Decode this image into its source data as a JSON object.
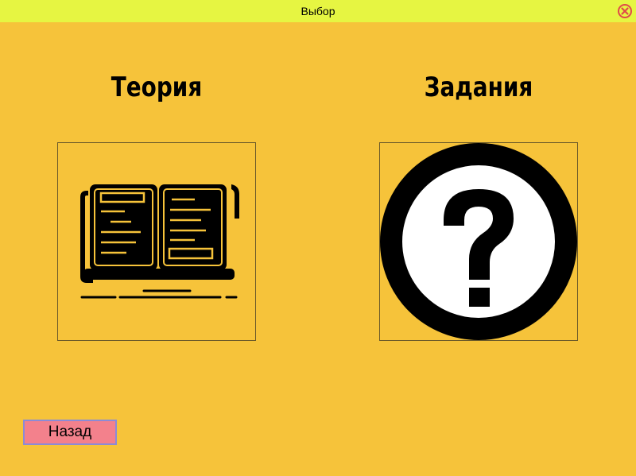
{
  "window": {
    "title": "Выбор",
    "close_icon": "close-circle-icon",
    "titlebar_color": "#e6f542",
    "close_color": "#e04a4a"
  },
  "background_color": "#f6c33a",
  "options": {
    "theory": {
      "label": "Теория",
      "icon": "open-book-icon"
    },
    "tasks": {
      "label": "Задания",
      "icon": "question-mark-icon"
    }
  },
  "buttons": {
    "back_label": "Назад",
    "back_color": "#f3818c"
  }
}
